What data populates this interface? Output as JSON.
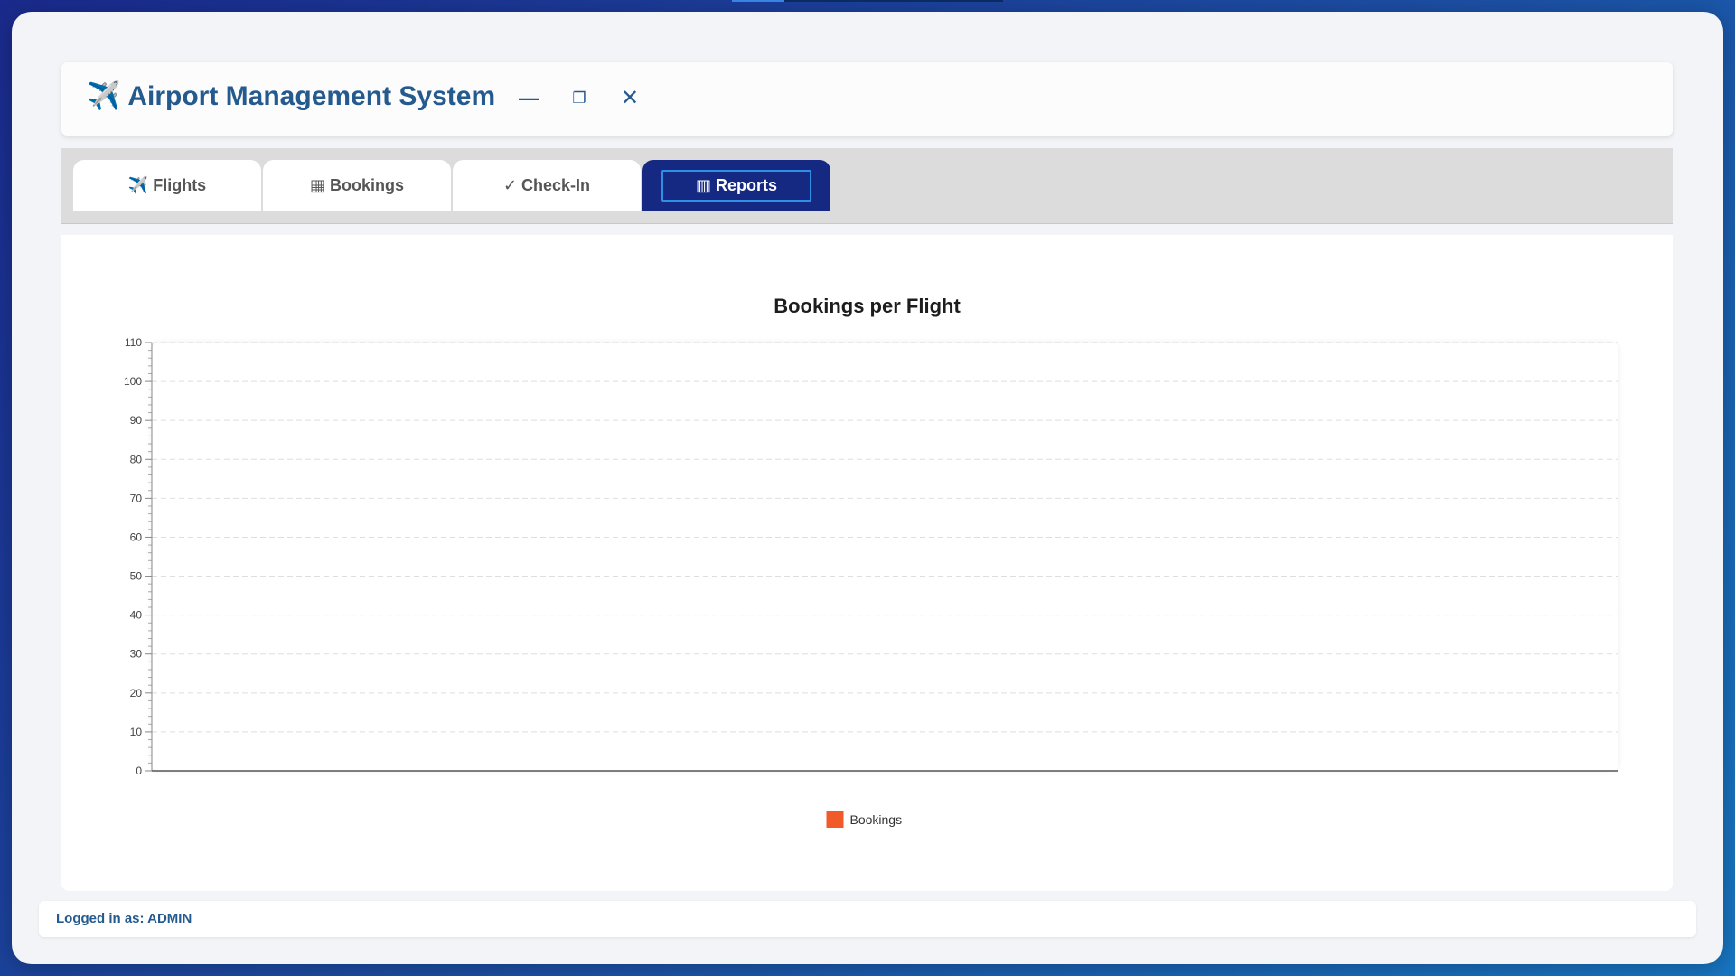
{
  "app": {
    "icon": "✈️",
    "title": "Airport Management System"
  },
  "window_controls": {
    "minimize": "—",
    "maximize": "❐",
    "close": "✕"
  },
  "tabs": [
    {
      "icon": "✈️",
      "label": "Flights",
      "active": false
    },
    {
      "icon": "▦",
      "label": "Bookings",
      "active": false
    },
    {
      "icon": "✓",
      "label": "Check-In",
      "active": false
    },
    {
      "icon": "▥",
      "label": "Reports",
      "active": true
    }
  ],
  "colors": {
    "accent": "#152983",
    "series": "#f15a29",
    "title": "#245a8e"
  },
  "chart_data": {
    "type": "bar",
    "title": "Bookings per Flight",
    "xlabel": "",
    "ylabel": "",
    "ylim": [
      0,
      110
    ],
    "yticks": [
      0,
      10,
      20,
      30,
      40,
      50,
      60,
      70,
      80,
      90,
      100,
      110
    ],
    "grid": true,
    "categories": [],
    "series": [
      {
        "name": "Bookings",
        "values": [],
        "color": "#f15a29"
      }
    ],
    "legend": "bottom-center"
  },
  "footer": {
    "status": "Logged in as: ADMIN"
  }
}
